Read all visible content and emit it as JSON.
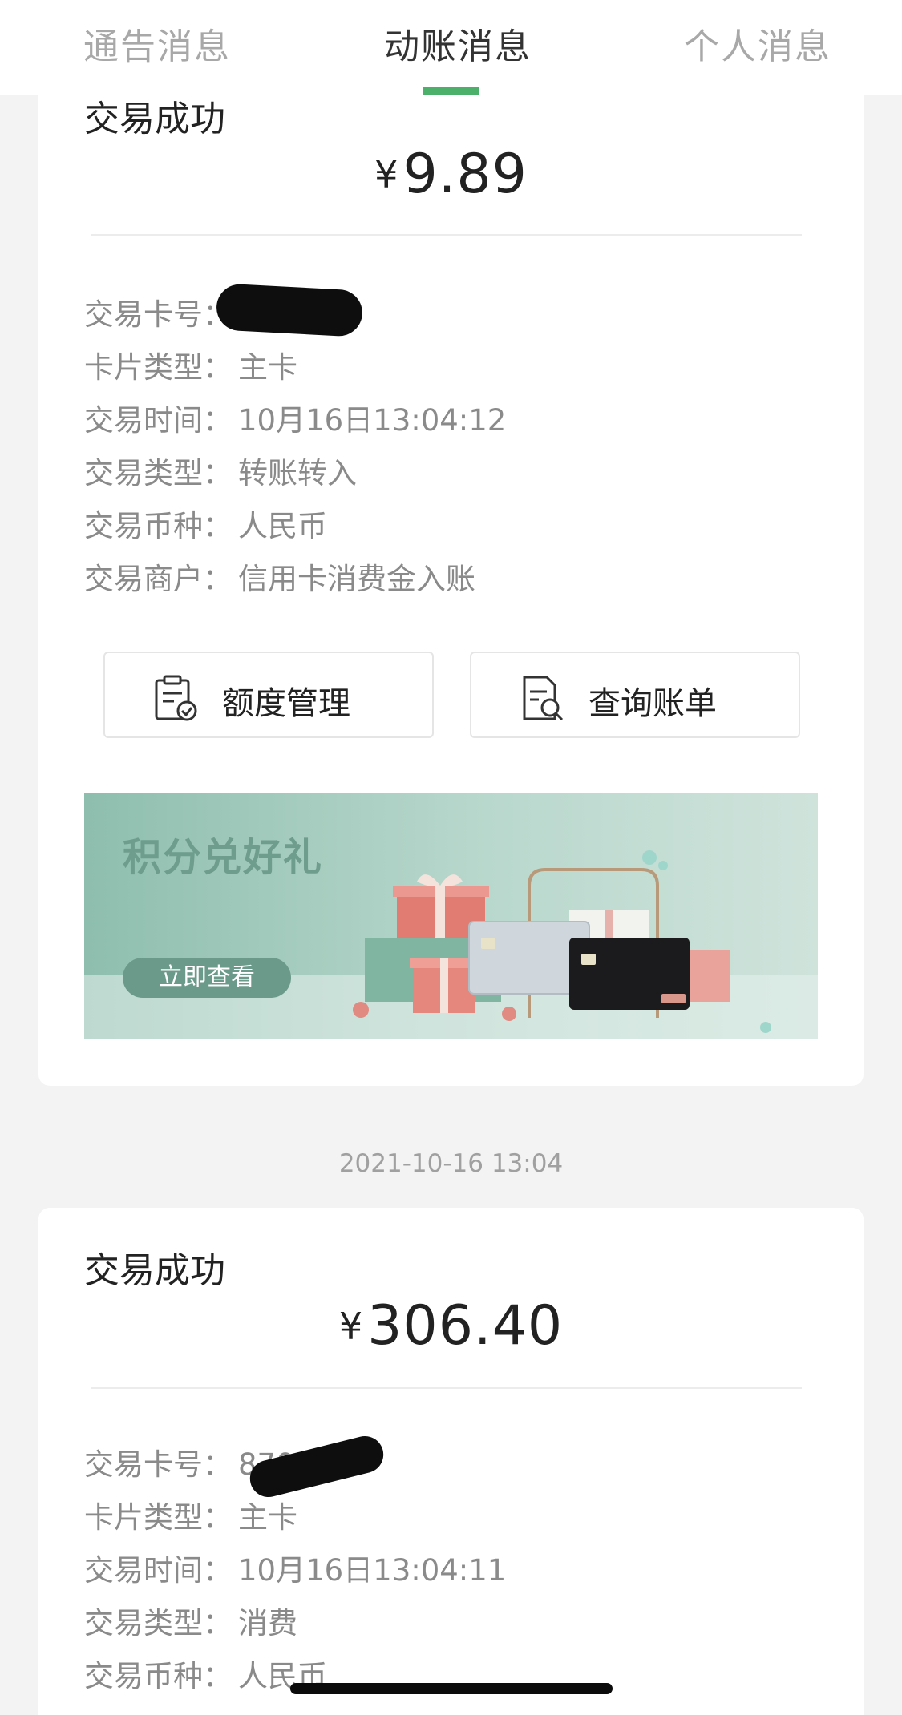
{
  "tabs": [
    {
      "label": "通告消息",
      "active": false
    },
    {
      "label": "动账消息",
      "active": true
    },
    {
      "label": "个人消息",
      "active": false
    }
  ],
  "accent_color": "#4caf6a",
  "transactions": [
    {
      "status": "交易成功",
      "currency_symbol": "¥",
      "amount": "9.89",
      "fields": [
        {
          "label": "交易卡号：",
          "value": ""
        },
        {
          "label": "卡片类型：",
          "value": "主卡"
        },
        {
          "label": "交易时间：",
          "value": "10月16日13:04:12"
        },
        {
          "label": "交易类型：",
          "value": "转账转入"
        },
        {
          "label": "交易币种：",
          "value": "人民币"
        },
        {
          "label": "交易商户：",
          "value": "信用卡消费金入账"
        }
      ],
      "actions": [
        {
          "label": "额度管理",
          "icon": "clipboard-check-icon"
        },
        {
          "label": "查询账单",
          "icon": "document-search-icon"
        }
      ],
      "banner": {
        "title": "积分兑好礼",
        "button": "立即查看"
      }
    },
    {
      "timestamp": "2021-10-16 13:04",
      "status": "交易成功",
      "currency_symbol": "¥",
      "amount": "306.40",
      "fields": [
        {
          "label": "交易卡号：",
          "value": "8700"
        },
        {
          "label": "卡片类型：",
          "value": "主卡"
        },
        {
          "label": "交易时间：",
          "value": "10月16日13:04:11"
        },
        {
          "label": "交易类型：",
          "value": "消费"
        },
        {
          "label": "交易币种：",
          "value": "人民币"
        }
      ]
    }
  ]
}
